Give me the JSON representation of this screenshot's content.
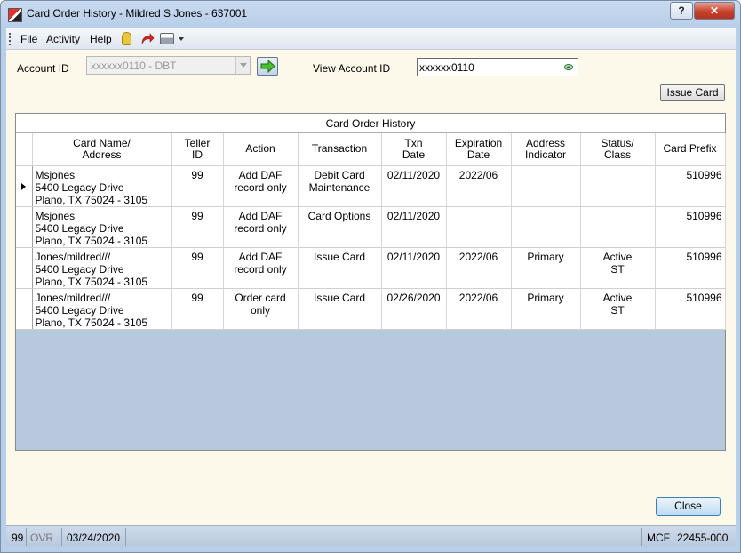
{
  "window": {
    "title": "Card Order History - Mildred S Jones - 637001",
    "help_label": "?",
    "close_label": "✕"
  },
  "menu": {
    "items": [
      {
        "label": "File"
      },
      {
        "label": "Activity"
      },
      {
        "label": "Help"
      }
    ],
    "icons": [
      "hand-icon",
      "redo-icon",
      "print-icon",
      "dropdown-icon"
    ]
  },
  "form": {
    "account_label": "Account ID",
    "account_value": "xxxxxx0110 - DBT",
    "view_label": "View Account ID",
    "view_value": "xxxxxx0110",
    "issue_card_label": "Issue Card",
    "close_label": "Close"
  },
  "grid": {
    "caption": "Card Order History",
    "columns": [
      {
        "label": "Card Name/\nAddress"
      },
      {
        "label": "Teller\nID"
      },
      {
        "label": "Action"
      },
      {
        "label": "Transaction"
      },
      {
        "label": "Txn\nDate"
      },
      {
        "label": "Expiration\nDate"
      },
      {
        "label": "Address\nIndicator"
      },
      {
        "label": "Status/\nClass"
      },
      {
        "label": "Card Prefix"
      }
    ],
    "rows": [
      {
        "name": "Msjones",
        "addr1": "5400 Legacy Drive",
        "addr2": "Plano, TX  75024 - 3105",
        "teller": "99",
        "action": "Add DAF record only",
        "transaction": "Debit Card Maintenance",
        "txn_date": "02/11/2020",
        "exp_date": "2022/06",
        "addr_ind": "",
        "status": "",
        "prefix": "510996"
      },
      {
        "name": "Msjones",
        "addr1": "5400 Legacy Drive",
        "addr2": "Plano, TX  75024 - 3105",
        "teller": "99",
        "action": "Add DAF record only",
        "transaction": "Card Options",
        "txn_date": "02/11/2020",
        "exp_date": "",
        "addr_ind": "",
        "status": "",
        "prefix": "510996"
      },
      {
        "name": "Jones/mildred///",
        "addr1": "5400 Legacy Drive",
        "addr2": "Plano, TX  75024 - 3105",
        "teller": "99",
        "action": "Add DAF record only",
        "transaction": "Issue Card",
        "txn_date": "02/11/2020",
        "exp_date": "2022/06",
        "addr_ind": "Primary",
        "status": "Active\nST",
        "prefix": "510996"
      },
      {
        "name": "Jones/mildred///",
        "addr1": "5400 Legacy Drive",
        "addr2": "Plano, TX  75024 - 3105",
        "teller": "99",
        "action": "Order card only",
        "transaction": "Issue Card",
        "txn_date": "02/26/2020",
        "exp_date": "2022/06",
        "addr_ind": "Primary",
        "status": "Active\nST",
        "prefix": "510996"
      }
    ]
  },
  "status": {
    "teller": "99",
    "ovr": "OVR",
    "date": "03/24/2020",
    "mcf": "MCF",
    "code": "22455-000"
  }
}
